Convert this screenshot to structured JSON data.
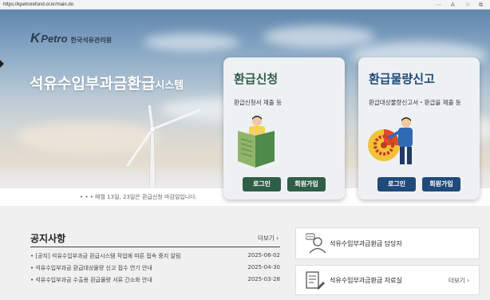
{
  "browser": {
    "url": "https://kpetrorefund.or.kr/main.do",
    "controls": [
      "⋯",
      "A",
      "☆",
      "⧉"
    ]
  },
  "logo": {
    "k": "K",
    "petro": "Petro",
    "org": "한국석유관리원"
  },
  "hero": {
    "title_main": "석유수입부과금환급",
    "title_sub": "시스템",
    "note": "• • • 매월 13일, 23일은 환급신청 마감일입니다."
  },
  "cards": [
    {
      "title": "환급신청",
      "desc": "환급신청서 제출 등",
      "login_label": "로그인",
      "join_label": "회원가입"
    },
    {
      "title": "환급물량신고",
      "desc": "환급대상물량신고서・환급을 제출 등",
      "login_label": "로그인",
      "join_label": "회원가입"
    }
  ],
  "notices": {
    "title": "공지사항",
    "more": "더보기 ›",
    "items": [
      {
        "text": "• [공지] 석유수입부과금 환급시스템 작업에 따른 접속 중지 알림",
        "date": "2025-06-02"
      },
      {
        "text": "• 석유수입부과금 환급대상물량 신고 접수 연기 안내",
        "date": "2025-04-30"
      },
      {
        "text": "• 석유수입부과금 수출용 환급물량 서류 간소화 안내",
        "date": "2025-03-28"
      }
    ]
  },
  "side": {
    "contact": "석유수입부과금환급 담당자",
    "library": "석유수입부과금환급 자료실",
    "library_more": "더보기 ›"
  },
  "colors": {
    "green": "#2f5e47",
    "blue": "#1f4a7a"
  }
}
